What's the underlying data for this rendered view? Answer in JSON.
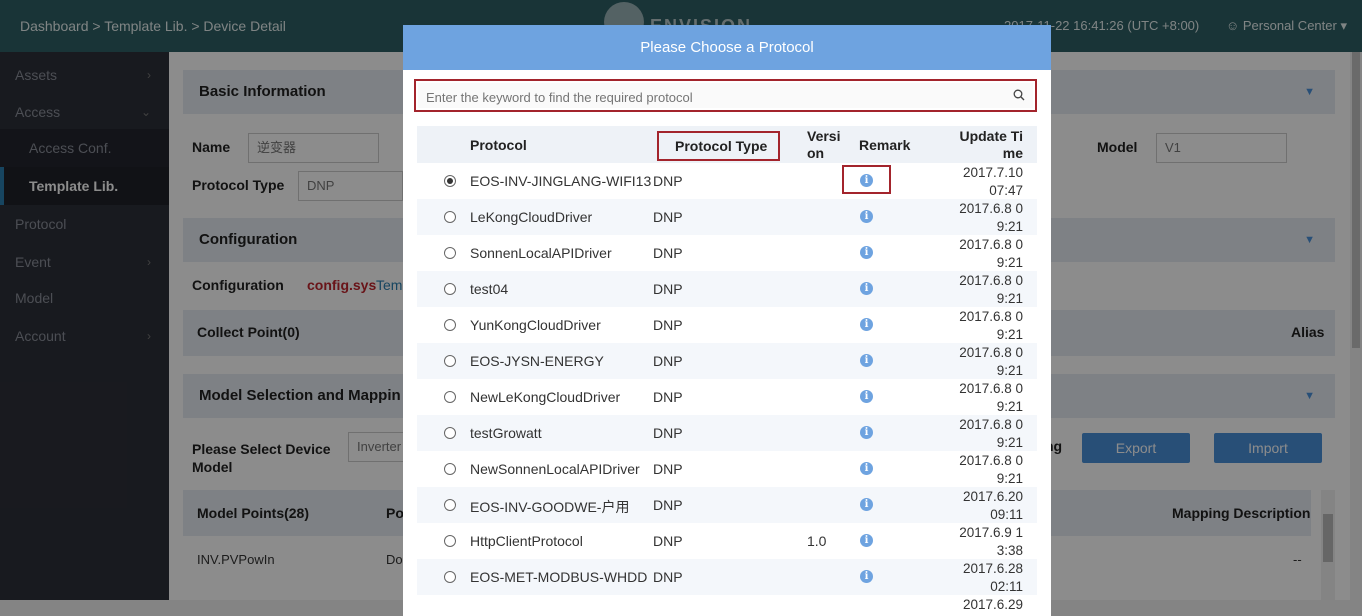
{
  "header": {
    "breadcrumb": "Dashboard > Template Lib. > Device Detail",
    "logo_text": "ENVISION",
    "datetime": "2017-11-22 16:41:26 (UTC +8:00)",
    "personal_center": "Personal Center"
  },
  "sidebar": {
    "items": [
      {
        "label": "Assets"
      },
      {
        "label": "Access"
      },
      {
        "label": "Access Conf."
      },
      {
        "label": "Template Lib."
      },
      {
        "label": "Protocol"
      },
      {
        "label": "Event"
      },
      {
        "label": "Model"
      },
      {
        "label": "Account"
      }
    ]
  },
  "main": {
    "basic_info_title": "Basic Information",
    "name_label": "Name",
    "name_value": "逆变器",
    "model_label": "Model",
    "model_value": "V1",
    "protocol_type_label": "Protocol Type",
    "protocol_type_value": "DNP",
    "configuration_title": "Configuration",
    "configuration_label": "Configuration",
    "config_file": "config.sys",
    "config_link": "Tem",
    "collect_point": "Collect Point(0)",
    "alias_label": "Alias",
    "model_selection_title": "Model Selection and Mappin",
    "select_device_model_label": "Please Select Device Model",
    "select_device_model_value": "Inverter",
    "mapping_partial": "ng",
    "export_label": "Export",
    "import_label": "Import",
    "model_points": "Model Points(28)",
    "po_header": "Po",
    "mapping_description": "Mapping Description",
    "first_row_point": "INV.PVPowIn",
    "first_row_po": "Do",
    "first_row_desc": "--"
  },
  "modal": {
    "title": "Please Choose a Protocol",
    "search_placeholder": "Enter the keyword to find the required protocol",
    "columns": {
      "protocol": "Protocol",
      "protocol_type": "Protocol Type",
      "version_1": "Versi",
      "version_2": "on",
      "remark": "Remark",
      "update_time_1": "Update Ti",
      "update_time_2": "me"
    },
    "rows": [
      {
        "selected": true,
        "protocol": "EOS-INV-JINGLANG-WIFI13",
        "type": "DNP",
        "version": "",
        "time_1": "2017.7.10",
        "time_2": "07:47"
      },
      {
        "selected": false,
        "protocol": "LeKongCloudDriver",
        "type": "DNP",
        "version": "",
        "time_1": "2017.6.8 0",
        "time_2": "9:21"
      },
      {
        "selected": false,
        "protocol": "SonnenLocalAPIDriver",
        "type": "DNP",
        "version": "",
        "time_1": "2017.6.8 0",
        "time_2": "9:21"
      },
      {
        "selected": false,
        "protocol": "test04",
        "type": "DNP",
        "version": "",
        "time_1": "2017.6.8 0",
        "time_2": "9:21"
      },
      {
        "selected": false,
        "protocol": "YunKongCloudDriver",
        "type": "DNP",
        "version": "",
        "time_1": "2017.6.8 0",
        "time_2": "9:21"
      },
      {
        "selected": false,
        "protocol": "EOS-JYSN-ENERGY",
        "type": "DNP",
        "version": "",
        "time_1": "2017.6.8 0",
        "time_2": "9:21"
      },
      {
        "selected": false,
        "protocol": "NewLeKongCloudDriver",
        "type": "DNP",
        "version": "",
        "time_1": "2017.6.8 0",
        "time_2": "9:21"
      },
      {
        "selected": false,
        "protocol": "testGrowatt",
        "type": "DNP",
        "version": "",
        "time_1": "2017.6.8 0",
        "time_2": "9:21"
      },
      {
        "selected": false,
        "protocol": "NewSonnenLocalAPIDriver",
        "type": "DNP",
        "version": "",
        "time_1": "2017.6.8 0",
        "time_2": "9:21"
      },
      {
        "selected": false,
        "protocol": "EOS-INV-GOODWE-户用",
        "type": "DNP",
        "version": "",
        "time_1": "2017.6.20",
        "time_2": "09:11"
      },
      {
        "selected": false,
        "protocol": "HttpClientProtocol",
        "type": "DNP",
        "version": "1.0",
        "time_1": "2017.6.9 1",
        "time_2": "3:38"
      },
      {
        "selected": false,
        "protocol": "EOS-MET-MODBUS-WHDD",
        "type": "DNP",
        "version": "",
        "time_1": "2017.6.28",
        "time_2": "02:11"
      },
      {
        "selected": false,
        "protocol": "",
        "type": "",
        "version": "",
        "time_1": "2017.6.29",
        "time_2": ""
      }
    ]
  },
  "colors": {
    "header_bg": "#2e5f64",
    "sidebar_bg": "#2d3039",
    "modal_header": "#6ea3e0",
    "highlight_box": "#a3242c",
    "button_blue": "#4a90d9"
  }
}
